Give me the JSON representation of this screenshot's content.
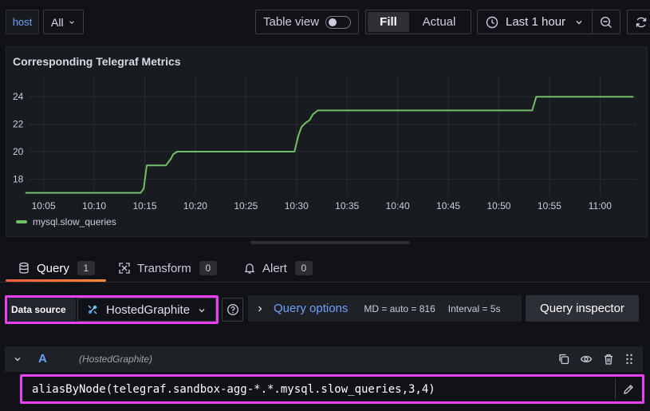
{
  "toolbar": {
    "host_variable": "host",
    "host_value": "All",
    "table_view_label": "Table view",
    "table_view_on": false,
    "fill_label": "Fill",
    "actual_label": "Actual",
    "time_range": "Last 1 hour"
  },
  "panel": {
    "title": "Corresponding Telegraf Metrics"
  },
  "chart_data": {
    "type": "line",
    "title": "Corresponding Telegraf Metrics",
    "xlabel": "",
    "ylabel": "",
    "x_ticks": [
      "10:05",
      "10:10",
      "10:15",
      "10:20",
      "10:25",
      "10:30",
      "10:35",
      "10:40",
      "10:45",
      "10:50",
      "10:55",
      "11:00"
    ],
    "y_ticks": [
      18,
      20,
      22,
      24
    ],
    "ylim": [
      16.8,
      25
    ],
    "xlim_minutes": [
      2.9,
      63.6
    ],
    "legend": "bottom-left",
    "grid": true,
    "series": [
      {
        "name": "mysql.slow_queries",
        "color": "#73bf69",
        "x_minutes": [
          3.2,
          14.6,
          14.9,
          15.2,
          17.1,
          17.6,
          17.8,
          18.2,
          29.8,
          30.2,
          30.5,
          30.9,
          31.3,
          31.6,
          32.1,
          53.3,
          53.7,
          63.3
        ],
        "values": [
          17,
          17,
          17.3,
          19,
          19,
          19.5,
          19.8,
          20,
          20,
          21.2,
          21.8,
          22.1,
          22.3,
          22.7,
          23,
          23,
          24,
          24
        ]
      }
    ]
  },
  "tabs": [
    {
      "label": "Query",
      "count": "1"
    },
    {
      "label": "Transform",
      "count": "0"
    },
    {
      "label": "Alert",
      "count": "0"
    }
  ],
  "query_row": {
    "datasource_label": "Data source",
    "datasource_value": "HostedGraphite",
    "query_options_label": "Query options",
    "md_text": "MD = auto = 816",
    "interval_text": "Interval = 5s",
    "inspector_label": "Query inspector"
  },
  "query": {
    "ref_id": "A",
    "datasource": "(HostedGraphite)",
    "text": "aliasByNode(telegraf.sandbox-agg-*.*.mysql.slow_queries,3,4)"
  }
}
